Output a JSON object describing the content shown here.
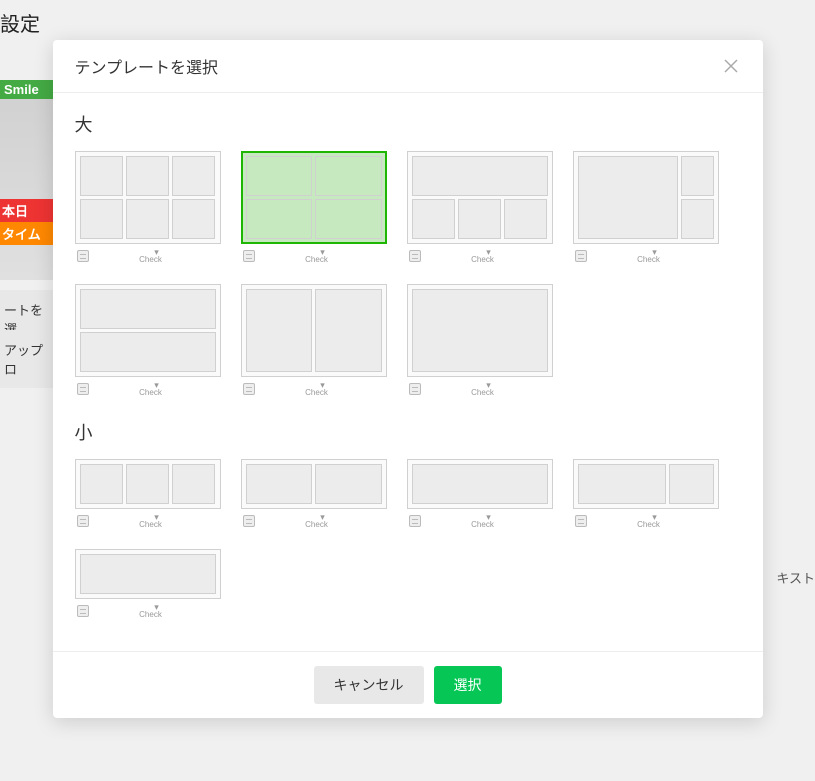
{
  "background": {
    "page_title": "設定",
    "thumb_label1": "Smile",
    "thumb_label2": "本日",
    "thumb_label3": "タイム",
    "side_item1": "ートを選",
    "side_item2": "アップロ",
    "text_label": "キスト"
  },
  "modal": {
    "title": "テンプレートを選択",
    "section_large": "大",
    "section_small": "小",
    "check_label": "Check",
    "footer": {
      "cancel": "キャンセル",
      "select": "選択"
    },
    "templates_large": [
      {
        "id": "l1",
        "layout": [
          [
            1,
            1,
            1
          ],
          [
            1,
            1,
            1
          ]
        ],
        "selected": false
      },
      {
        "id": "l2",
        "layout": [
          [
            1,
            1
          ],
          [
            1,
            1
          ]
        ],
        "selected": true
      },
      {
        "id": "l3",
        "layout": [
          [
            1
          ],
          [
            1,
            1,
            1
          ]
        ],
        "selected": false
      },
      {
        "id": "l4",
        "layout": "vcol",
        "selected": false
      },
      {
        "id": "l5",
        "layout": [
          [
            1
          ],
          [
            1
          ]
        ],
        "selected": false
      },
      {
        "id": "l6",
        "layout": [
          [
            1,
            1
          ]
        ],
        "selected": false
      },
      {
        "id": "l7",
        "layout": [
          [
            1
          ]
        ],
        "selected": false
      }
    ],
    "templates_small": [
      {
        "id": "s1",
        "layout": [
          [
            1,
            1,
            1
          ]
        ]
      },
      {
        "id": "s2",
        "layout": [
          [
            1,
            1
          ]
        ]
      },
      {
        "id": "s3",
        "layout": [
          [
            1
          ]
        ]
      },
      {
        "id": "s4",
        "layout": [
          [
            "w2",
            1
          ]
        ]
      },
      {
        "id": "s5",
        "layout": [
          [
            1
          ]
        ]
      }
    ]
  }
}
